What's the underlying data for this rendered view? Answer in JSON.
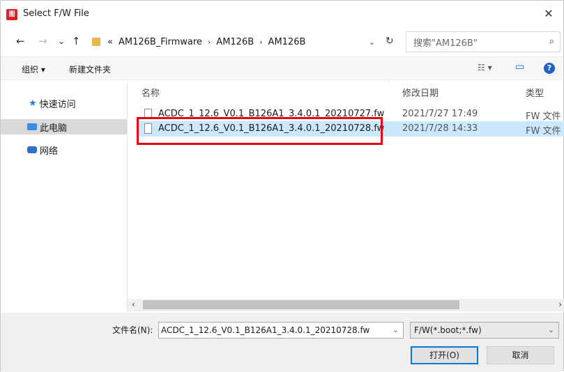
{
  "window": {
    "title": "Select F/W File",
    "close_glyph": "✕",
    "app_icon_glyph": "图"
  },
  "nav": {
    "back": "←",
    "forward": "→",
    "recent": "⌄",
    "up": "↑"
  },
  "address": {
    "overflow": "«",
    "crumbs": [
      "AM126B_Firmware",
      "AM126B",
      "AM126B"
    ],
    "separator": "›",
    "dropdown": "⌄",
    "refresh": "↻"
  },
  "search": {
    "placeholder": "搜索\"AM126B\"",
    "icon": "⌕"
  },
  "toolbar": {
    "organize": "组织 ▾",
    "new_folder": "新建文件夹",
    "view": "☷ ▾",
    "pane": "▭",
    "help": "?"
  },
  "sidebar": {
    "items": [
      {
        "label": "快速访问",
        "icon": "star-icon",
        "color": "#2b7cd3"
      },
      {
        "label": "此电脑",
        "icon": "computer-icon",
        "color": "#3a8ee6"
      },
      {
        "label": "网络",
        "icon": "network-icon",
        "color": "#2d72c8"
      }
    ]
  },
  "columns": {
    "name": "名称",
    "date": "修改日期",
    "type": "类型",
    "sort_arrow": "^"
  },
  "files": [
    {
      "name": "ACDC_1_12.6_V0.1_B126A1_3.4.0.1_20210727.fw",
      "date": "2021/7/27 17:49",
      "type": "FW 文件"
    },
    {
      "name": "ACDC_1_12.6_V0.1_B126A1_3.4.0.1_20210728.fw",
      "date": "2021/7/28 14:33",
      "type": "FW 文件"
    }
  ],
  "scrollbar": {
    "left": "‹",
    "right": "›"
  },
  "footer": {
    "filename_label": "文件名(N):",
    "filename_value": "ACDC_1_12.6_V0.1_B126A1_3.4.0.1_20210728.fw",
    "filetype": "F/W(*.boot;*.fw)",
    "dropdown": "⌄",
    "open": "打开(O)",
    "cancel": "取消"
  },
  "colors": {
    "accent": "#0078d7",
    "selection": "#cce8ff",
    "highlight_box": "#e60012"
  }
}
